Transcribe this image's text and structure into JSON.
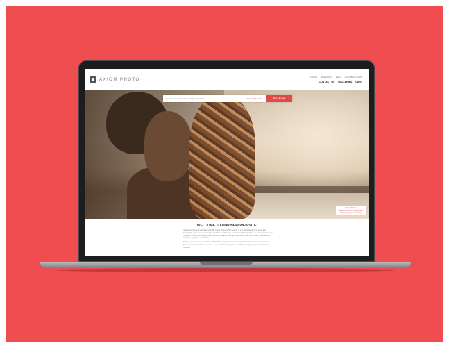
{
  "site": {
    "logo_text": "AXIOM PHOTO",
    "nav_top": [
      "ABOUT",
      "RESEARCH",
      "HELP",
      "LIGHTBOX LOGIN"
    ],
    "nav_bottom": [
      "CONTACT US",
      "GALLERIES",
      "CART"
    ]
  },
  "search": {
    "placeholder": "Search keywords, places, & photographers",
    "advanced_label": "Advanced Search",
    "button_label": "SEARCH"
  },
  "hero": {
    "caption_lines": [
      "Image: Solomon",
      "Islands by Axiom Photographer",
      "More images by Axiom Photo"
    ],
    "caption_link": "Islands"
  },
  "welcome": {
    "title": "WELCOME TO OUR NEW WEB SITE!",
    "paragraphs": [
      "Established in London, England in 1998, Axiom Photographic Agency is a multi-award-winning travel and photography agency representing the work of a handful of the world's best photographers. Our images capture the essence of places and people, cultures and landscapes, offering a fascinating view of our world. We work with publishers, agencies, and brands.",
      "We hope you like our new web site and will find it easy to browse and search. Should you wish to contact us, please get in touch by phone or email — we are always happy to help with your image requests and licensing enquiries."
    ]
  },
  "colors": {
    "background": "#ef4d4f",
    "accent": "#e24a4a",
    "laptop_bezel": "#1d1d1f"
  }
}
